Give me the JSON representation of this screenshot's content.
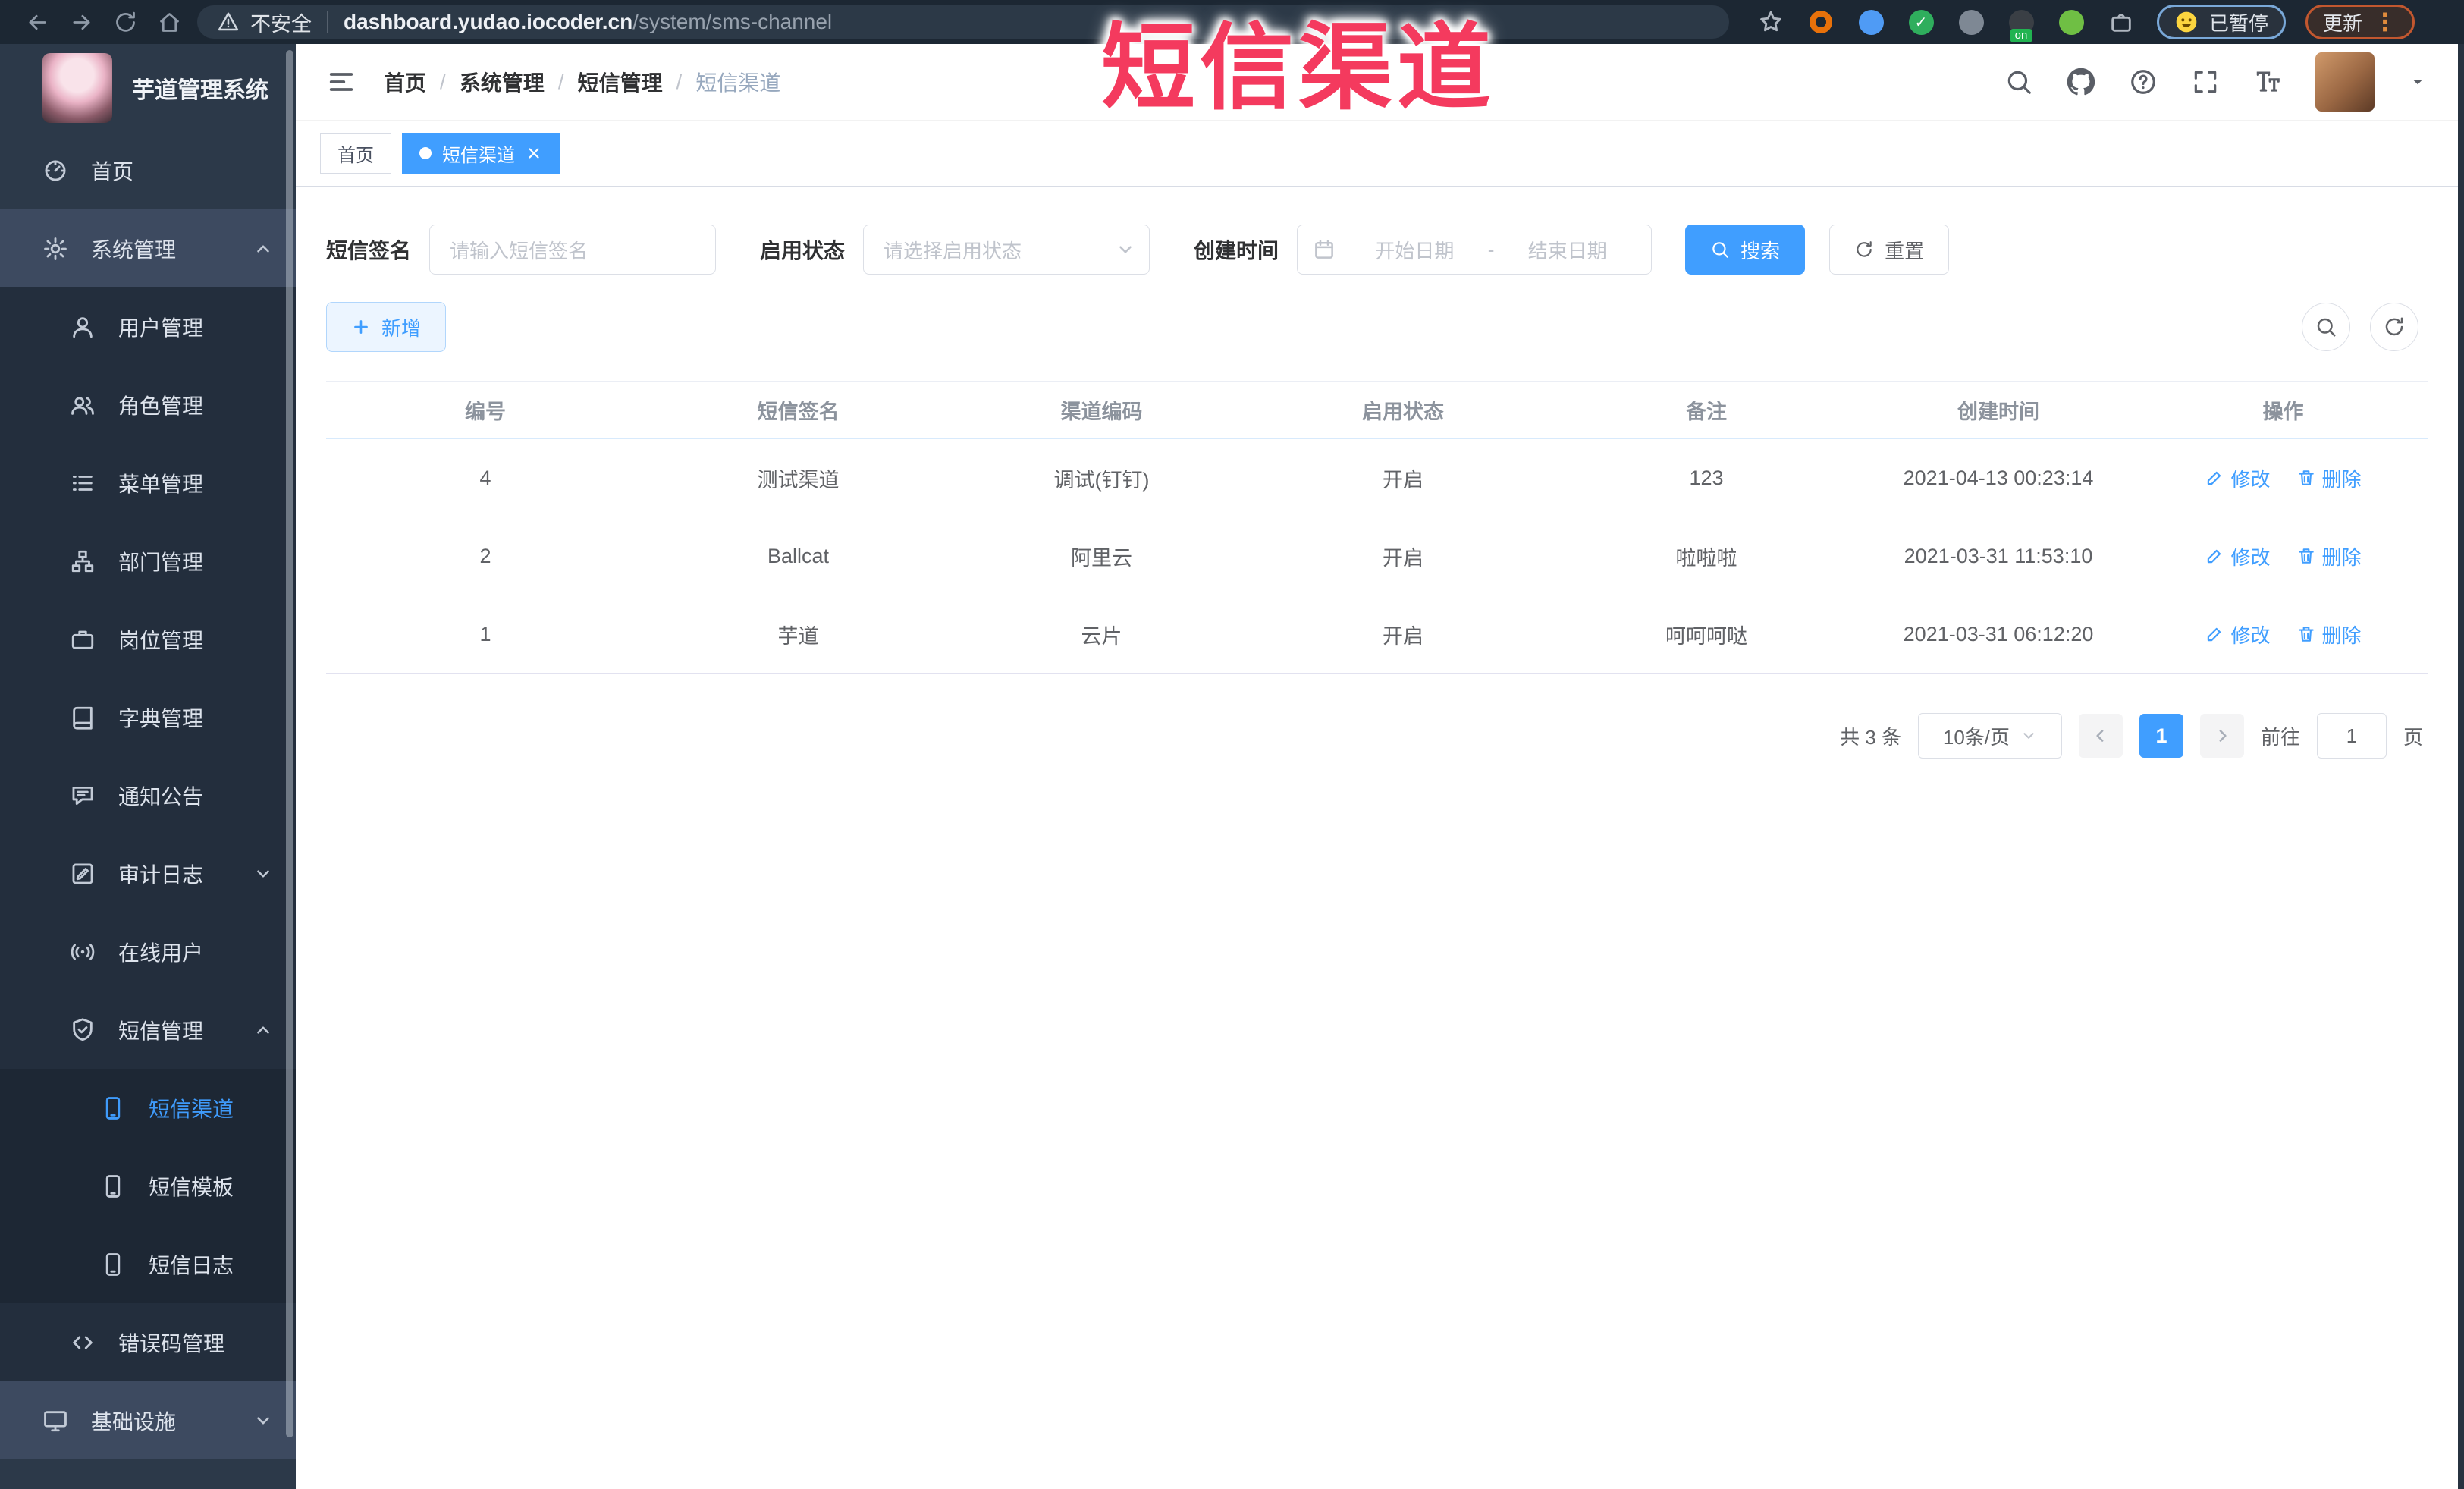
{
  "browser": {
    "security_label": "不安全",
    "url_host": "dashboard.yudao.iocoder.cn",
    "url_path": "/system/sms-channel",
    "paused_label": "已暂停",
    "update_label": "更新",
    "extensions": [
      {
        "name": "bookmark-star",
        "shape": "star"
      },
      {
        "name": "ext-orange-ring",
        "shape": "ring",
        "color": "#e8710a"
      },
      {
        "name": "ext-blue-drop",
        "shape": "blob",
        "color": "#4f9bf5"
      },
      {
        "name": "ext-green-check",
        "shape": "blob",
        "color": "#2fae5d",
        "glyph": "✓"
      },
      {
        "name": "ext-gray-tools",
        "shape": "blob",
        "color": "#7e8894"
      },
      {
        "name": "ext-dark-panel",
        "shape": "blob",
        "color": "#3a3f45",
        "badge": "on",
        "badge_color": "#21b351"
      },
      {
        "name": "ext-green-leaf",
        "shape": "blob",
        "color": "#6fbf44"
      },
      {
        "name": "extensions-puzzle",
        "shape": "puzzle"
      }
    ]
  },
  "overlay_title": "短信渠道",
  "sidebar": {
    "app_title": "芋道管理系统",
    "items": [
      {
        "key": "home",
        "label": "首页",
        "icon": "dashboard",
        "level": 0
      },
      {
        "key": "system",
        "label": "系统管理",
        "icon": "gear",
        "level": 0,
        "highlight": true,
        "chevron": "up"
      },
      {
        "key": "user-mgmt",
        "label": "用户管理",
        "icon": "user",
        "level": 1
      },
      {
        "key": "role-mgmt",
        "label": "角色管理",
        "icon": "users",
        "level": 1
      },
      {
        "key": "menu-mgmt",
        "label": "菜单管理",
        "icon": "list",
        "level": 1
      },
      {
        "key": "dept-mgmt",
        "label": "部门管理",
        "icon": "tree",
        "level": 1
      },
      {
        "key": "post-mgmt",
        "label": "岗位管理",
        "icon": "briefcase",
        "level": 1
      },
      {
        "key": "dict-mgmt",
        "label": "字典管理",
        "icon": "book",
        "level": 1
      },
      {
        "key": "notice",
        "label": "通知公告",
        "icon": "chat",
        "level": 1
      },
      {
        "key": "audit-log",
        "label": "审计日志",
        "icon": "edit",
        "level": 1,
        "chevron": "down"
      },
      {
        "key": "online-user",
        "label": "在线用户",
        "icon": "online",
        "level": 1
      },
      {
        "key": "sms-mgmt",
        "label": "短信管理",
        "icon": "shield",
        "level": 1,
        "chevron": "up"
      },
      {
        "key": "sms-channel",
        "label": "短信渠道",
        "icon": "phone",
        "level": 2,
        "active": true
      },
      {
        "key": "sms-template",
        "label": "短信模板",
        "icon": "phone",
        "level": 2
      },
      {
        "key": "sms-log",
        "label": "短信日志",
        "icon": "phone",
        "level": 2
      },
      {
        "key": "error-code",
        "label": "错误码管理",
        "icon": "code",
        "level": 1
      },
      {
        "key": "infra",
        "label": "基础设施",
        "icon": "monitor",
        "level": 0,
        "highlight": true,
        "chevron": "down"
      }
    ]
  },
  "header": {
    "breadcrumb": [
      "首页",
      "系统管理",
      "短信管理",
      "短信渠道"
    ]
  },
  "tabs": [
    {
      "label": "首页"
    },
    {
      "label": "短信渠道"
    }
  ],
  "filters": {
    "signature_label": "短信签名",
    "signature_placeholder": "请输入短信签名",
    "status_label": "启用状态",
    "status_placeholder": "请选择启用状态",
    "date_label": "创建时间",
    "date_start_placeholder": "开始日期",
    "date_separator": "-",
    "date_end_placeholder": "结束日期",
    "search_label": "搜索",
    "reset_label": "重置"
  },
  "toolbar": {
    "add_label": "新增"
  },
  "table": {
    "columns": [
      "编号",
      "短信签名",
      "渠道编码",
      "启用状态",
      "备注",
      "创建时间",
      "操作"
    ],
    "cell_keys": [
      "id",
      "signature",
      "code",
      "status",
      "remark",
      "created"
    ],
    "rows": [
      {
        "id": "4",
        "signature": "测试渠道",
        "code": "调试(钉钉)",
        "status": "开启",
        "remark": "123",
        "created": "2021-04-13 00:23:14"
      },
      {
        "id": "2",
        "signature": "Ballcat",
        "code": "阿里云",
        "status": "开启",
        "remark": "啦啦啦",
        "created": "2021-03-31 11:53:10"
      },
      {
        "id": "1",
        "signature": "芋道",
        "code": "云片",
        "status": "开启",
        "remark": "呵呵呵哒",
        "created": "2021-03-31 06:12:20"
      }
    ],
    "action_edit": "修改",
    "action_delete": "删除"
  },
  "pagination": {
    "total": "共 3 条",
    "page_size": "10条/页",
    "current_page": "1",
    "goto_label": "前往",
    "goto_value": "1",
    "page_unit": "页"
  },
  "colors": {
    "accent": "#409eff",
    "overlay_title": "#f43a5e",
    "sidebar_bg": "#2c3949",
    "browser_bar_bg": "#1c2733"
  }
}
